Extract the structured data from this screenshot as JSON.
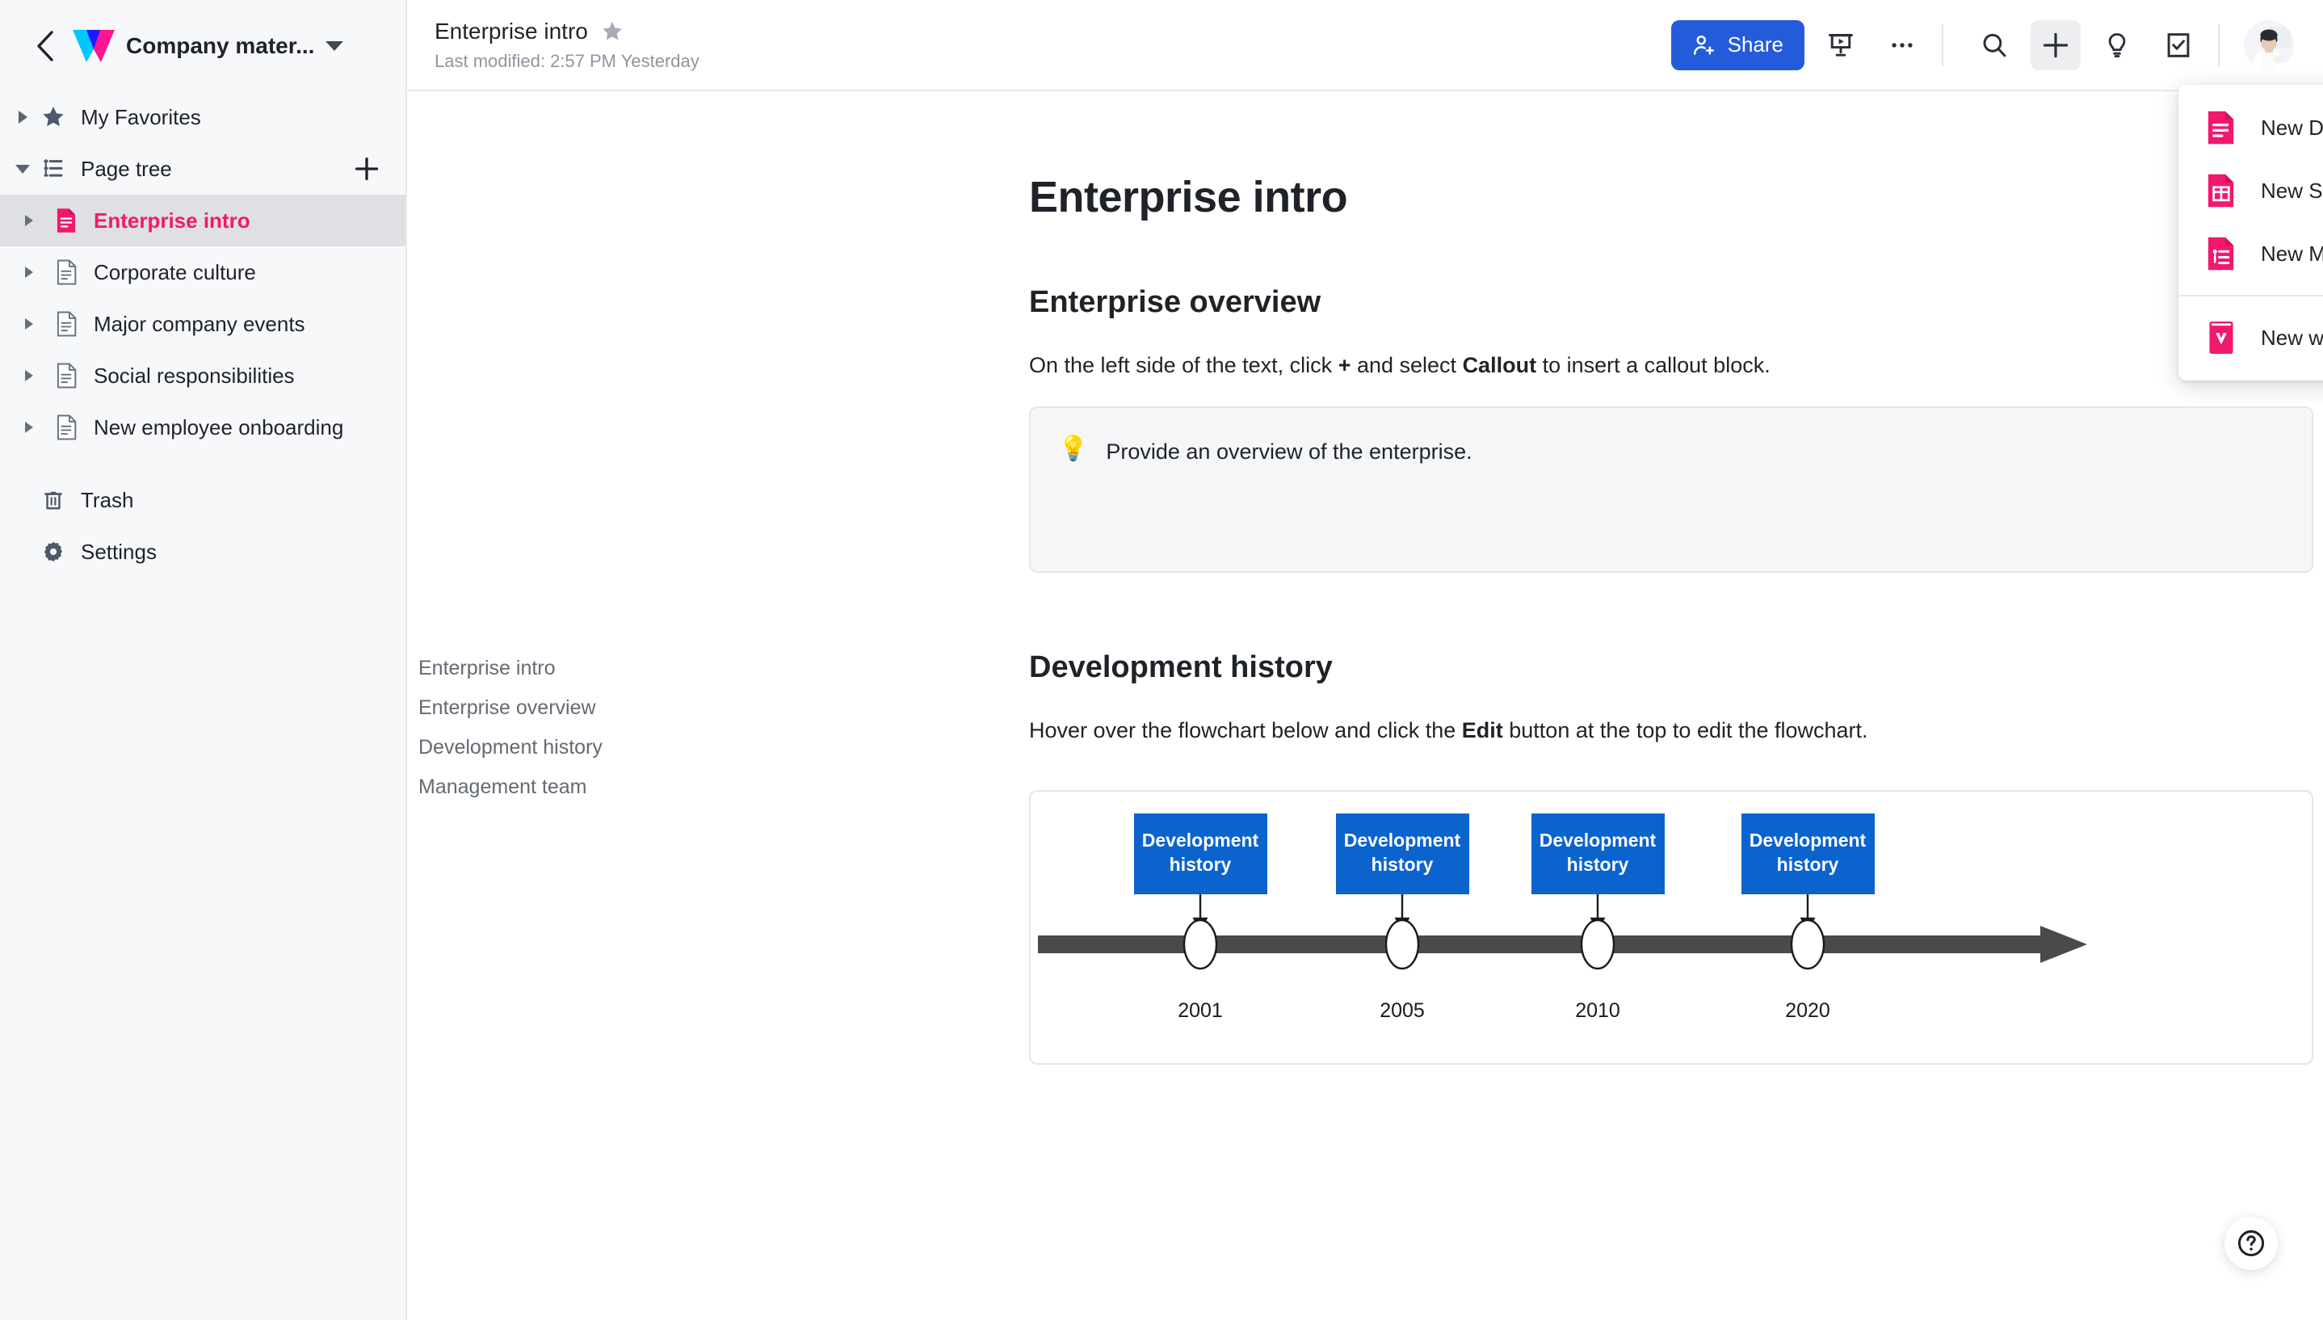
{
  "sidebar": {
    "workspace_title": "Company mater...",
    "back_icon": "chevron-left-icon",
    "logo_icon": "wps-logo-icon",
    "caret_icon": "chevron-down-icon",
    "favorites": {
      "label": "My Favorites",
      "icon": "star-icon"
    },
    "page_tree": {
      "label": "Page tree",
      "icon": "page-tree-icon",
      "add_icon": "plus-icon"
    },
    "pages": [
      {
        "label": "Enterprise intro",
        "icon": "doc-icon",
        "active": true
      },
      {
        "label": "Corporate culture",
        "icon": "doc-icon",
        "active": false
      },
      {
        "label": "Major company events",
        "icon": "doc-icon",
        "active": false
      },
      {
        "label": "Social responsibilities",
        "icon": "doc-icon",
        "active": false
      },
      {
        "label": "New employee onboarding",
        "icon": "doc-icon",
        "active": false
      }
    ],
    "footer": [
      {
        "label": "Trash",
        "icon": "trash-icon"
      },
      {
        "label": "Settings",
        "icon": "gear-icon"
      }
    ]
  },
  "topbar": {
    "doc_title": "Enterprise intro",
    "star_icon": "star-icon",
    "last_modified": "Last modified: 2:57 PM Yesterday",
    "share_label": "Share",
    "share_icon": "person-add-icon",
    "share_color": "#245bdb",
    "icons": [
      {
        "name": "presentation-icon"
      },
      {
        "name": "more-horizontal-icon"
      },
      {
        "name": "search-icon"
      },
      {
        "name": "plus-icon",
        "active": true
      },
      {
        "name": "lightbulb-icon"
      },
      {
        "name": "task-checkbox-icon"
      }
    ],
    "avatar": "user-avatar"
  },
  "create_menu": {
    "accent_color": "#f2186e",
    "items": [
      {
        "label": "New Docs",
        "icon": "new-docs-icon"
      },
      {
        "label": "New Sheets",
        "icon": "new-sheets-icon"
      },
      {
        "label": "New MindNotes",
        "icon": "new-mindnotes-icon"
      }
    ],
    "footer_items": [
      {
        "label": "New workspace",
        "icon": "new-workspace-icon"
      }
    ]
  },
  "outline": {
    "items": [
      {
        "label": "Enterprise intro"
      },
      {
        "label": "Enterprise overview"
      },
      {
        "label": "Development history"
      },
      {
        "label": "Management team"
      }
    ]
  },
  "document": {
    "title": "Enterprise intro",
    "section_overview": {
      "heading": "Enterprise overview",
      "paragraph_pre": "On the left side of the text, click ",
      "paragraph_bold1": "+",
      "paragraph_mid": " and select ",
      "paragraph_bold2": "Callout",
      "paragraph_post": " to insert a callout block.",
      "callout_icon": "💡",
      "callout_text": "Provide an overview of the enterprise."
    },
    "section_history": {
      "heading": "Development history",
      "paragraph_pre": "Hover over the flowchart below and click the ",
      "paragraph_bold": "Edit",
      "paragraph_post": " button at the top to edit the flowchart."
    }
  },
  "chart_data": {
    "type": "timeline",
    "title": "Development history",
    "axis_label": "",
    "node_color": "#0b63ce",
    "axis_color": "#4a4a4a",
    "categories": [
      "2001",
      "2005",
      "2010",
      "2020"
    ],
    "labels": [
      "Development history",
      "Development history",
      "Development history",
      "Development history"
    ],
    "nodes": [
      {
        "year": "2001",
        "label": "Development history"
      },
      {
        "year": "2005",
        "label": "Development history"
      },
      {
        "year": "2010",
        "label": "Development history"
      },
      {
        "year": "2020",
        "label": "Development history"
      }
    ]
  },
  "help": {
    "icon": "question-circle-icon"
  }
}
